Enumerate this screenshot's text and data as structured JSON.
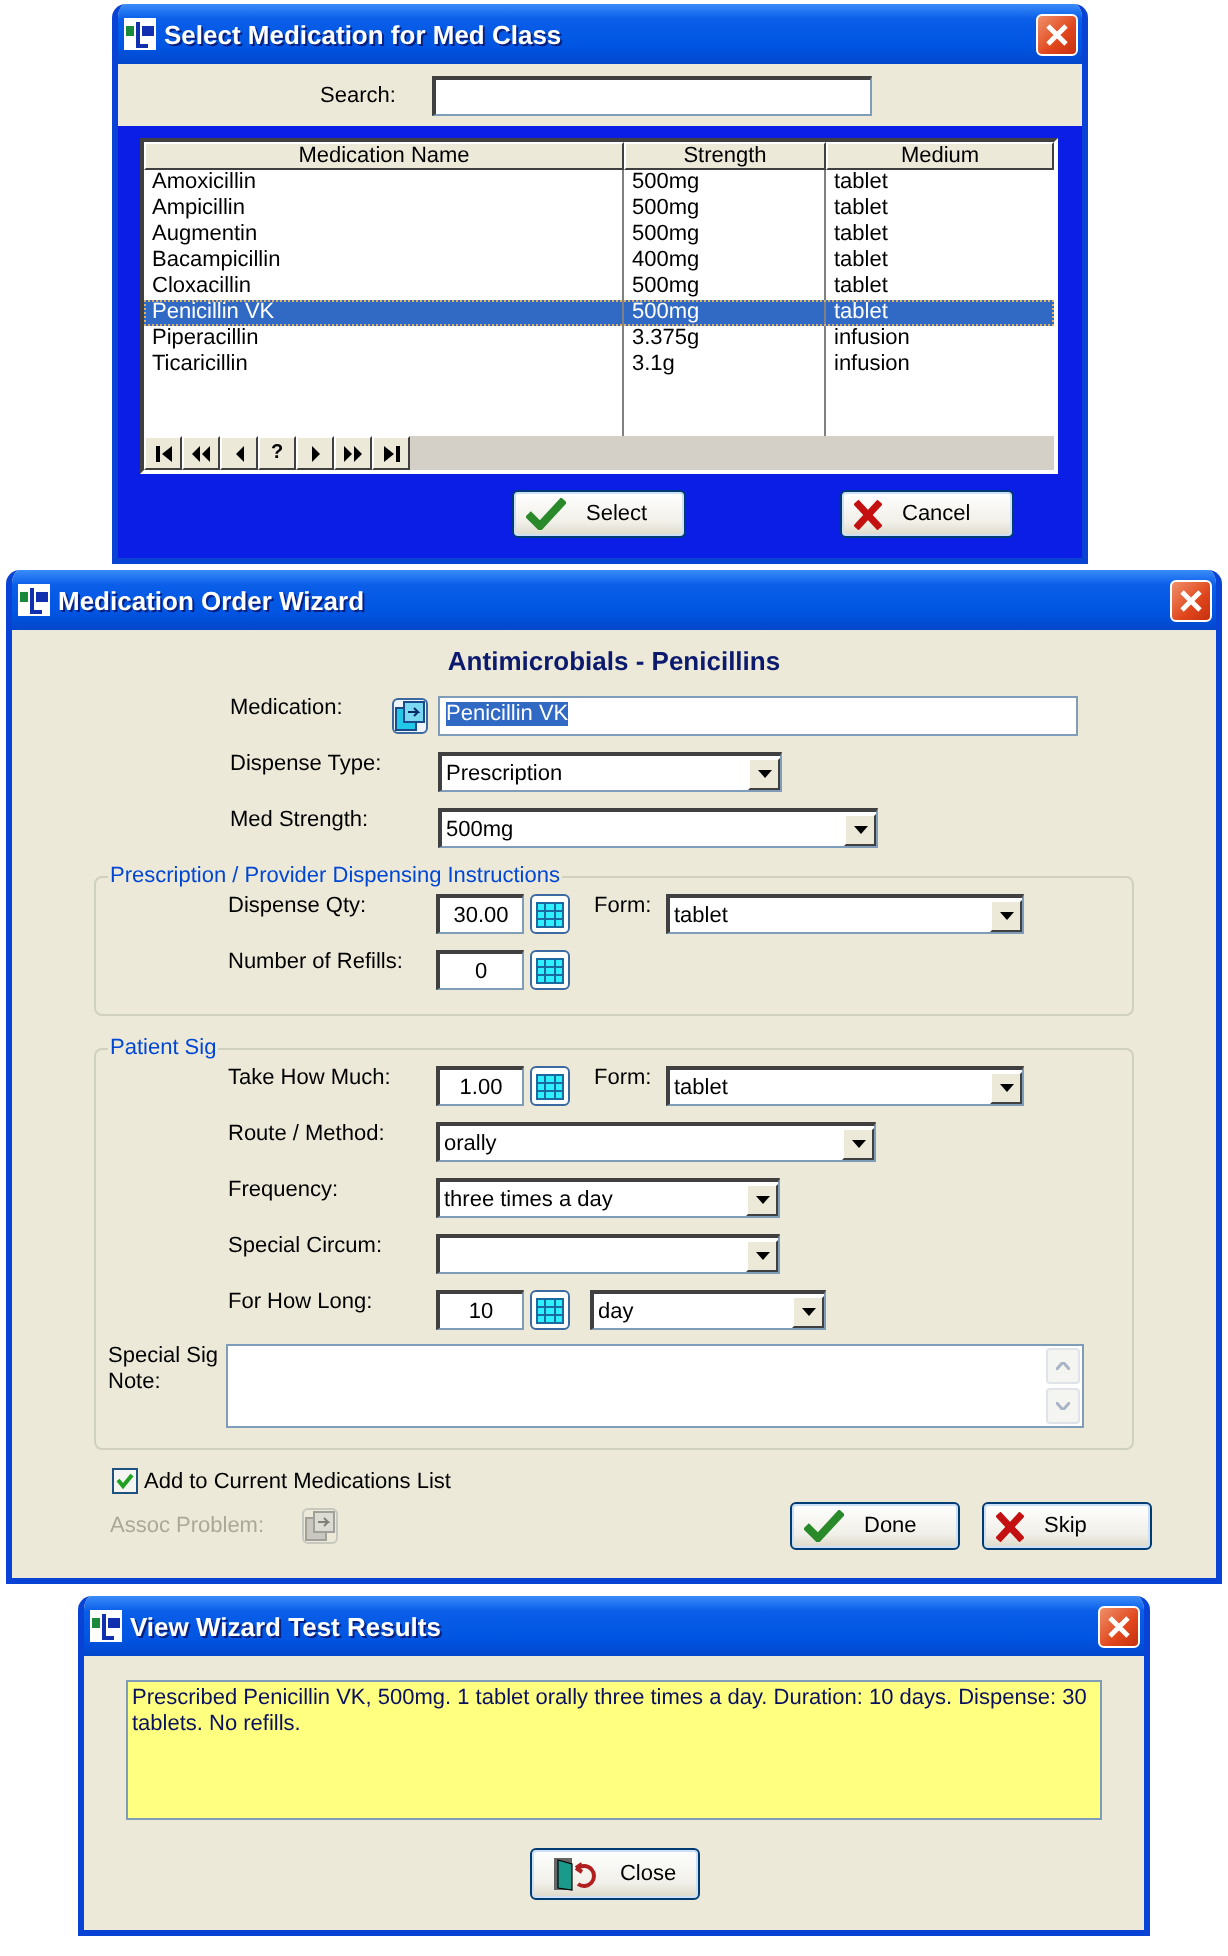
{
  "select_dialog": {
    "title": "Select Medication for Med Class",
    "search": {
      "label": "Search:"
    },
    "table": {
      "columns": [
        "Medication Name",
        "Strength",
        "Medium"
      ],
      "rows": [
        {
          "cells": [
            "Amoxicillin",
            "500mg",
            "tablet"
          ],
          "selected": false
        },
        {
          "cells": [
            "Ampicillin",
            "500mg",
            "tablet"
          ],
          "selected": false
        },
        {
          "cells": [
            "Augmentin",
            "500mg",
            "tablet"
          ],
          "selected": false
        },
        {
          "cells": [
            "Bacampicillin",
            "400mg",
            "tablet"
          ],
          "selected": false
        },
        {
          "cells": [
            "Cloxacillin",
            "500mg",
            "tablet"
          ],
          "selected": false
        },
        {
          "cells": [
            "Penicillin VK",
            "500mg",
            "tablet"
          ],
          "selected": true
        },
        {
          "cells": [
            "Piperacillin",
            "3.375g",
            "infusion"
          ],
          "selected": false
        },
        {
          "cells": [
            "Ticaricillin",
            "3.1g",
            "infusion"
          ],
          "selected": false
        }
      ]
    },
    "navigator": [
      {
        "kind": "first"
      },
      {
        "kind": "prev_page"
      },
      {
        "kind": "prev"
      },
      {
        "kind": "help",
        "label": "?"
      },
      {
        "kind": "next"
      },
      {
        "kind": "next_page"
      },
      {
        "kind": "last"
      }
    ],
    "buttons": [
      {
        "label": "Select",
        "kind": "ok"
      },
      {
        "label": "Cancel",
        "kind": "cancel"
      }
    ]
  },
  "wizard": {
    "title": "Medication Order Wizard",
    "heading": "Antimicrobials - Penicillins",
    "top_rows": [
      {
        "label": "Medication:",
        "kind": "picker",
        "value": "Penicillin VK",
        "highlighted": true
      },
      {
        "label": "Dispense Type:",
        "kind": "dropdown",
        "value": "Prescription"
      },
      {
        "label": "Med Strength:",
        "kind": "dropdown",
        "value": "500mg"
      }
    ],
    "groups": [
      {
        "title": "Prescription / Provider Dispensing Instructions",
        "rows": [
          {
            "label": "Dispense Qty:",
            "kind": "number",
            "value": "30.00",
            "form": {
              "label": "Form:",
              "value": "tablet"
            }
          },
          {
            "label": "Number of Refills:",
            "kind": "number",
            "value": "0"
          }
        ]
      },
      {
        "title": "Patient Sig",
        "rows": [
          {
            "label": "Take How Much:",
            "kind": "number",
            "value": "1.00",
            "form": {
              "label": "Form:",
              "value": "tablet"
            }
          },
          {
            "label": "Route / Method:",
            "kind": "dropdown",
            "value": "orally"
          },
          {
            "label": "Frequency:",
            "kind": "dropdown",
            "value": "three times a day"
          },
          {
            "label": "Special Circum:",
            "kind": "dropdown"
          },
          {
            "label": "For How Long:",
            "kind": "number",
            "value": "10",
            "unit": "day"
          }
        ],
        "note": {
          "label": "Special Sig Note:"
        }
      }
    ],
    "add_to_list": {
      "label": "Add to Current Medications List",
      "checked": true
    },
    "assoc_problem": {
      "label": "Assoc Problem:",
      "disabled": true
    },
    "buttons": [
      {
        "label": "Done",
        "kind": "ok"
      },
      {
        "label": "Skip",
        "kind": "cancel"
      }
    ]
  },
  "results": {
    "title": "View Wizard Test Results",
    "text": "Prescribed Penicillin VK, 500mg. 1 tablet orally three times a day. Duration: 10 days. Dispense: 30 tablets. No refills.",
    "buttons": [
      {
        "label": "Close",
        "kind": "close"
      }
    ]
  }
}
